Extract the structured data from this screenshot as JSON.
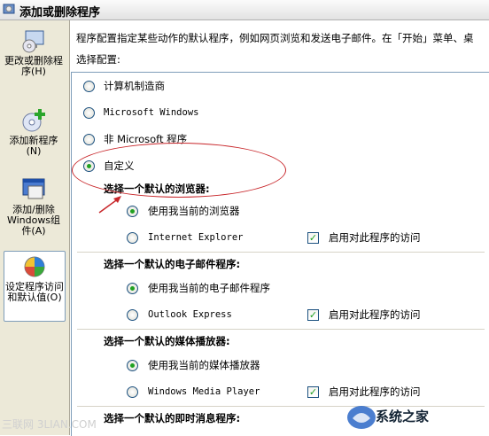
{
  "window": {
    "title": "添加或删除程序",
    "title_icon": "add-remove-icon"
  },
  "sidebar": {
    "items": [
      {
        "label": "更改或删除程序(H)",
        "icon": "cd-monitor-icon",
        "active": false
      },
      {
        "label": "添加新程序(N)",
        "icon": "add-cd-icon",
        "active": false
      },
      {
        "label": "添加/删除Windows组件(A)",
        "icon": "windows-components-icon",
        "active": false
      },
      {
        "label": "设定程序访问和默认值(O)",
        "icon": "default-programs-icon",
        "active": true
      }
    ]
  },
  "main": {
    "intro": "程序配置指定某些动作的默认程序，例如网页浏览和发送电子邮件。在「开始」菜单、桌",
    "config_label": "选择配置:",
    "options": [
      {
        "label": "计算机制造商",
        "selected": false
      },
      {
        "label": "Microsoft Windows",
        "selected": false
      },
      {
        "label": "非 Microsoft 程序",
        "selected": false
      },
      {
        "label": "自定义",
        "selected": true
      }
    ],
    "sections": [
      {
        "heading": "选择一个默认的浏览器:",
        "current": "使用我当前的浏览器",
        "alt": "Internet Explorer",
        "enable": "启用对此程序的访问"
      },
      {
        "heading": "选择一个默认的电子邮件程序:",
        "current": "使用我当前的电子邮件程序",
        "alt": "Outlook Express",
        "enable": "启用对此程序的访问"
      },
      {
        "heading": "选择一个默认的媒体播放器:",
        "current": "使用我当前的媒体播放器",
        "alt": "Windows Media Player",
        "enable": "启用对此程序的访问"
      },
      {
        "heading": "选择一个默认的即时消息程序:"
      }
    ]
  },
  "overlay": {
    "annotation_color": "#c8262a",
    "watermark": "三联网 3LIAN.COM",
    "logo_text": "系统之家"
  }
}
